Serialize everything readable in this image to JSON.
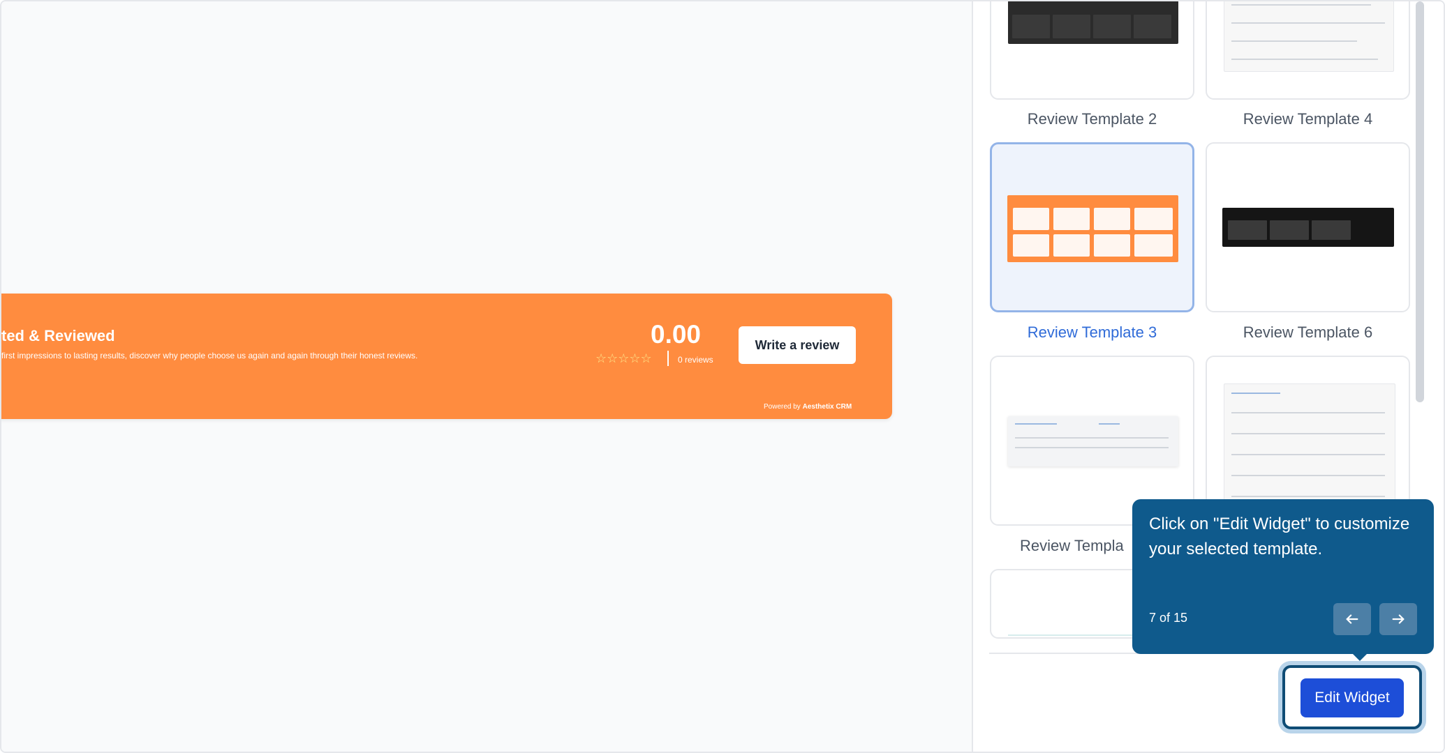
{
  "preview": {
    "banner": {
      "title": "ted & Reviewed",
      "subtitle": " first impressions to lasting results, discover why people choose us again and again through their honest reviews.",
      "rating_score": "0.00",
      "stars": "☆☆☆☆☆",
      "review_count": "0 reviews",
      "write_button": "Write a review",
      "powered_prefix": "Powered by",
      "powered_brand": "Aesthetix CRM",
      "color": "#ff8c3f"
    }
  },
  "templates": [
    {
      "label": "Review Template 2",
      "selected": false,
      "style": "dark-grid"
    },
    {
      "label": "Review Template 4",
      "selected": false,
      "style": "list"
    },
    {
      "label": "Review Template 3",
      "selected": true,
      "style": "orange-grid"
    },
    {
      "label": "Review Template 6",
      "selected": false,
      "style": "dark-banner"
    },
    {
      "label": "Review Templa",
      "selected": false,
      "style": "light-card"
    },
    {
      "label": "",
      "selected": false,
      "style": "list"
    }
  ],
  "tooltip": {
    "text": "Click on \"Edit Widget\" to customize your selected template.",
    "step": "7 of 15",
    "prev_icon": "arrow-left-icon",
    "next_icon": "arrow-right-icon",
    "color": "#0f5a8c"
  },
  "edit_widget": {
    "label": "Edit Widget",
    "color": "#1d4ed8"
  }
}
